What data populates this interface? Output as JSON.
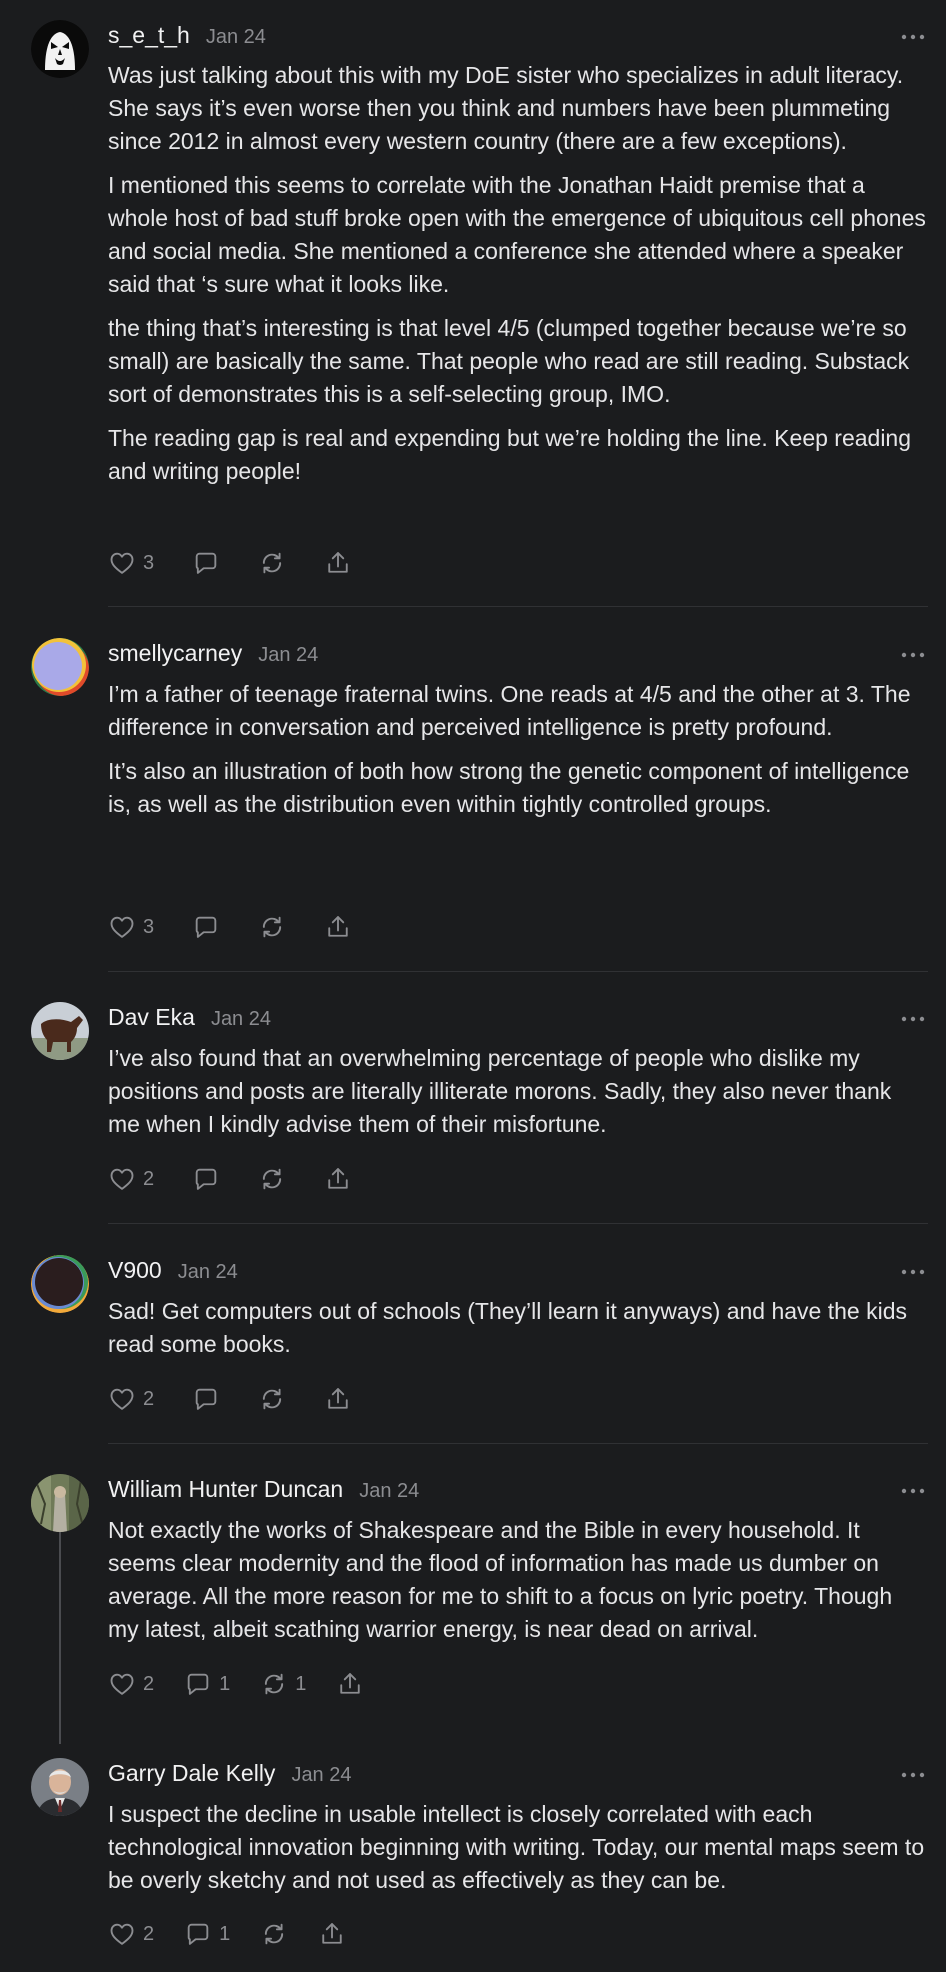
{
  "comments": [
    {
      "username": "s_e_t_h",
      "date": "Jan 24",
      "paragraphs": [
        "Was just talking about this with my DoE sister who specializes in adult literacy. She says it’s even worse then you think and numbers have been plummeting since 2012 in almost every western country (there are a few exceptions).",
        "I mentioned this seems to correlate with the Jonathan Haidt premise that a whole host of bad stuff broke open with the emergence of ubiquitous cell phones and social media. She mentioned a conference she attended where a speaker said that ‘s sure what it looks like.",
        "the thing that’s interesting is that level 4/5 (clumped together because we’re so small) are basically the same. That people who read are still reading. Substack sort of demonstrates this is a self-selecting group, IMO.",
        "The reading gap is real and expending but we’re holding the line. Keep reading and writing people!"
      ],
      "likes": "3",
      "replies": "",
      "restacks": ""
    },
    {
      "username": "smellycarney",
      "date": "Jan 24",
      "paragraphs": [
        "I’m a father of teenage fraternal twins. One reads at 4/5 and the other at 3. The difference in conversation and perceived intelligence is pretty profound.",
        "It’s also an illustration of both how strong the genetic component of intelligence is, as well as the distribution even within tightly controlled groups."
      ],
      "likes": "3",
      "replies": "",
      "restacks": ""
    },
    {
      "username": "Dav Eka",
      "date": "Jan 24",
      "paragraphs": [
        "I’ve also found that an overwhelming percentage of people who dislike my positions and posts are literally illiterate morons. Sadly, they also never thank me when I kindly advise them of their misfortune."
      ],
      "likes": "2",
      "replies": "",
      "restacks": ""
    },
    {
      "username": "V900",
      "date": "Jan 24",
      "paragraphs": [
        "Sad! Get computers out of schools (They’ll learn it anyways) and have the kids read some books."
      ],
      "likes": "2",
      "replies": "",
      "restacks": ""
    },
    {
      "username": "William Hunter Duncan",
      "date": "Jan 24",
      "paragraphs": [
        "Not exactly the works of Shakespeare and the Bible in every household. It seems clear modernity and the flood of information has made us dumber on average. All the more reason for me to shift to a focus on lyric poetry. Though my latest, albeit scathing warrior energy, is near dead on arrival."
      ],
      "likes": "2",
      "replies": "1",
      "restacks": "1"
    },
    {
      "username": "Garry Dale Kelly",
      "date": "Jan 24",
      "paragraphs": [
        "I suspect the decline in usable intellect is closely correlated with each technological innovation beginning with writing. Today, our mental maps seem to be overly sketchy and not used as effectively as they can be."
      ],
      "likes": "2",
      "replies": "1",
      "restacks": ""
    }
  ],
  "icons": {
    "like": "heart-icon",
    "reply": "comment-bubble-icon",
    "restack": "restack-icon",
    "share": "share-icon",
    "more": "more-dots-icon"
  },
  "colors": {
    "background": "#1b1c1e",
    "text": "#e6e6e8",
    "muted": "#8c8d91",
    "divider": "#303134"
  }
}
